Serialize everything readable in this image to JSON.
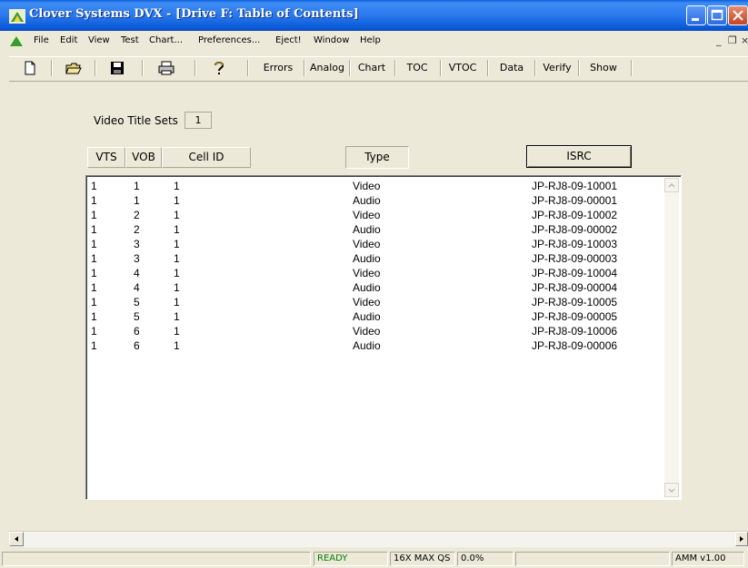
{
  "window": {
    "title": "Clover Systems DVX - [Drive F: Table of Contents]"
  },
  "menu": {
    "items": [
      "File",
      "Edit",
      "View",
      "Test",
      "Chart...",
      "Preferences...",
      "Eject!",
      "Window",
      "Help"
    ],
    "mdi_minimize": "_",
    "mdi_restore": "❐",
    "mdi_close": "×"
  },
  "toolbar": {
    "icons": [
      "new-icon",
      "open-icon",
      "save-icon",
      "print-icon",
      "help-icon"
    ],
    "buttons": [
      "Errors",
      "Analog",
      "Chart",
      "TOC",
      "VTOC",
      "Data",
      "Verify",
      "Show"
    ]
  },
  "summary": {
    "vts_label": "Video Title Sets",
    "vts_value": "1"
  },
  "table": {
    "headers": {
      "vts": "VTS",
      "vob": "VOB",
      "cell": "Cell ID",
      "type": "Type",
      "isrc": "ISRC"
    },
    "rows": [
      {
        "vts": "1",
        "vob": "1",
        "cell": "1",
        "type": "Video",
        "isrc": "JP-RJ8-09-10001"
      },
      {
        "vts": "1",
        "vob": "1",
        "cell": "1",
        "type": "Audio",
        "isrc": "JP-RJ8-09-00001"
      },
      {
        "vts": "1",
        "vob": "2",
        "cell": "1",
        "type": "Video",
        "isrc": "JP-RJ8-09-10002"
      },
      {
        "vts": "1",
        "vob": "2",
        "cell": "1",
        "type": "Audio",
        "isrc": "JP-RJ8-09-00002"
      },
      {
        "vts": "1",
        "vob": "3",
        "cell": "1",
        "type": "Video",
        "isrc": "JP-RJ8-09-10003"
      },
      {
        "vts": "1",
        "vob": "3",
        "cell": "1",
        "type": "Audio",
        "isrc": "JP-RJ8-09-00003"
      },
      {
        "vts": "1",
        "vob": "4",
        "cell": "1",
        "type": "Video",
        "isrc": "JP-RJ8-09-10004"
      },
      {
        "vts": "1",
        "vob": "4",
        "cell": "1",
        "type": "Audio",
        "isrc": "JP-RJ8-09-00004"
      },
      {
        "vts": "1",
        "vob": "5",
        "cell": "1",
        "type": "Video",
        "isrc": "JP-RJ8-09-10005"
      },
      {
        "vts": "1",
        "vob": "5",
        "cell": "1",
        "type": "Audio",
        "isrc": "JP-RJ8-09-00005"
      },
      {
        "vts": "1",
        "vob": "6",
        "cell": "1",
        "type": "Video",
        "isrc": "JP-RJ8-09-10006"
      },
      {
        "vts": "1",
        "vob": "6",
        "cell": "1",
        "type": "Audio",
        "isrc": "JP-RJ8-09-00006"
      }
    ]
  },
  "status": {
    "state": "READY",
    "state_color": "#008000",
    "drive": "16X MAX QS",
    "progress": "0.0%",
    "version": "AMM v1.00"
  }
}
